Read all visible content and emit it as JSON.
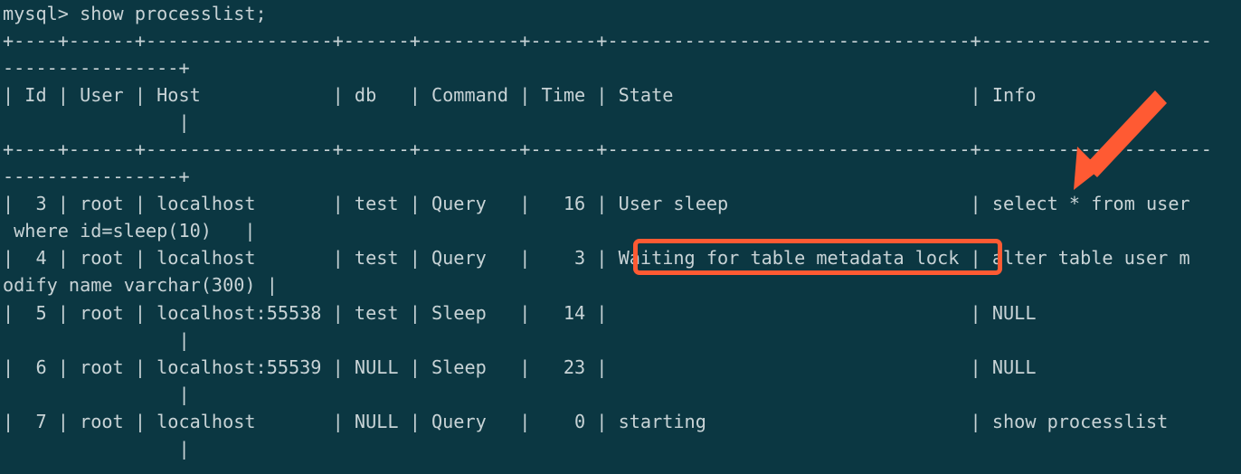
{
  "terminal": {
    "window_title": "mysql terminal",
    "background_color": "#0b3742",
    "foreground_color": "#c8d3d6",
    "annotation_color": "#ff5a33",
    "prompt": "mysql>",
    "command": "show processlist;",
    "prompt_line": "mysql> show processlist;",
    "wrap_columns": 113,
    "separator_line": "+----+------+-----------------+------+---------+------+---------------------------------+-------------------------------------+",
    "columns": [
      {
        "name": "Id",
        "width": 4
      },
      {
        "name": "User",
        "width": 6
      },
      {
        "name": "Host",
        "width": 17
      },
      {
        "name": "db",
        "width": 6
      },
      {
        "name": "Command",
        "width": 9
      },
      {
        "name": "Time",
        "width": 6
      },
      {
        "name": "State",
        "width": 33
      },
      {
        "name": "Info",
        "width": 37
      }
    ],
    "header_row": {
      "Id": "Id",
      "User": "User",
      "Host": "Host",
      "db": "db",
      "Command": "Command",
      "Time": "Time",
      "State": "State",
      "Info": "Info"
    },
    "rows": [
      {
        "Id": "3",
        "User": "root",
        "Host": "localhost",
        "db": "test",
        "Command": "Query",
        "Time": "16",
        "State": "User sleep",
        "Info": "select * from user where id=sleep(10)"
      },
      {
        "Id": "4",
        "User": "root",
        "Host": "localhost",
        "db": "test",
        "Command": "Query",
        "Time": "3",
        "State": "Waiting for table metadata lock",
        "Info": "alter table user modify name varchar(300)",
        "highlighted": true
      },
      {
        "Id": "5",
        "User": "root",
        "Host": "localhost:55538",
        "db": "test",
        "Command": "Sleep",
        "Time": "14",
        "State": "",
        "Info": "NULL"
      },
      {
        "Id": "6",
        "User": "root",
        "Host": "localhost:55539",
        "db": "NULL",
        "Command": "Sleep",
        "Time": "23",
        "State": "",
        "Info": "NULL"
      },
      {
        "Id": "7",
        "User": "root",
        "Host": "localhost",
        "db": "NULL",
        "Command": "Query",
        "Time": "0",
        "State": "starting",
        "Info": "show processlist"
      }
    ],
    "rendered_lines": [
      "mysql> show processlist;",
      "+----+------+-----------------+------+---------+------+---------------------------------+---------------------",
      "----------------+",
      "| Id | User | Host            | db   | Command | Time | State                           | Info                ",
      "                |",
      "+----+------+-----------------+------+---------+------+---------------------------------+---------------------",
      "----------------+",
      "|  3 | root | localhost       | test | Query   |   16 | User sleep                      | select * from user  ",
      " where id=sleep(10)   |",
      "|  4 | root | localhost       | test | Query   |    3 | Waiting for table metadata lock | alter table user m",
      "odify name varchar(300) |",
      "|  5 | root | localhost:55538 | test | Sleep   |   14 |                                 | NULL                ",
      "                |",
      "|  6 | root | localhost:55539 | NULL | Sleep   |   23 |                                 | NULL                ",
      "                |",
      "|  7 | root | localhost       | NULL | Query   |    0 | starting                        | show processlist    ",
      "                |"
    ]
  },
  "annotations": {
    "arrow": {
      "name": "pointer-arrow",
      "color": "#ff5a33",
      "direction": "down-left",
      "points_to": "select * from user"
    },
    "highlight_box": {
      "name": "metadata-lock-highlight",
      "color": "#ff5a33",
      "target_text": "Waiting for table metadata lock"
    }
  }
}
